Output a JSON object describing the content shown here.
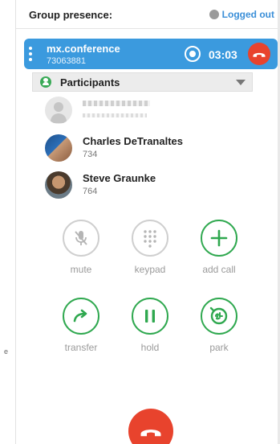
{
  "header": {
    "title": "Group presence:",
    "status_label": "Logged out",
    "status_color": "#9a9a9a",
    "link_color": "#3b8fd8"
  },
  "call": {
    "name": "mx.conference",
    "number": "73063881",
    "timer": "03:03",
    "bar_color": "#3b9ade",
    "hangup_color": "#e8432d",
    "icons": [
      "drag-handle-icon",
      "record-icon",
      "hangup-icon"
    ]
  },
  "participants": {
    "label": "Participants",
    "items": [
      {
        "name": "",
        "ext": "",
        "avatar": "generic"
      },
      {
        "name": "Charles DeTranaltes",
        "ext": "734",
        "avatar": "photo"
      },
      {
        "name": "Steve Graunke",
        "ext": "764",
        "avatar": "photo"
      }
    ]
  },
  "controls": [
    {
      "label": "mute",
      "icon": "mic-off-icon",
      "active": false
    },
    {
      "label": "keypad",
      "icon": "keypad-icon",
      "active": false
    },
    {
      "label": "add call",
      "icon": "plus-icon",
      "active": true
    },
    {
      "label": "transfer",
      "icon": "transfer-arrow-icon",
      "active": true
    },
    {
      "label": "hold",
      "icon": "pause-icon",
      "active": true
    },
    {
      "label": "park",
      "icon": "park-clock-icon",
      "active": true
    }
  ],
  "accent_green": "#2fa84f",
  "end_call_color": "#e8432d",
  "side_mark": "e"
}
